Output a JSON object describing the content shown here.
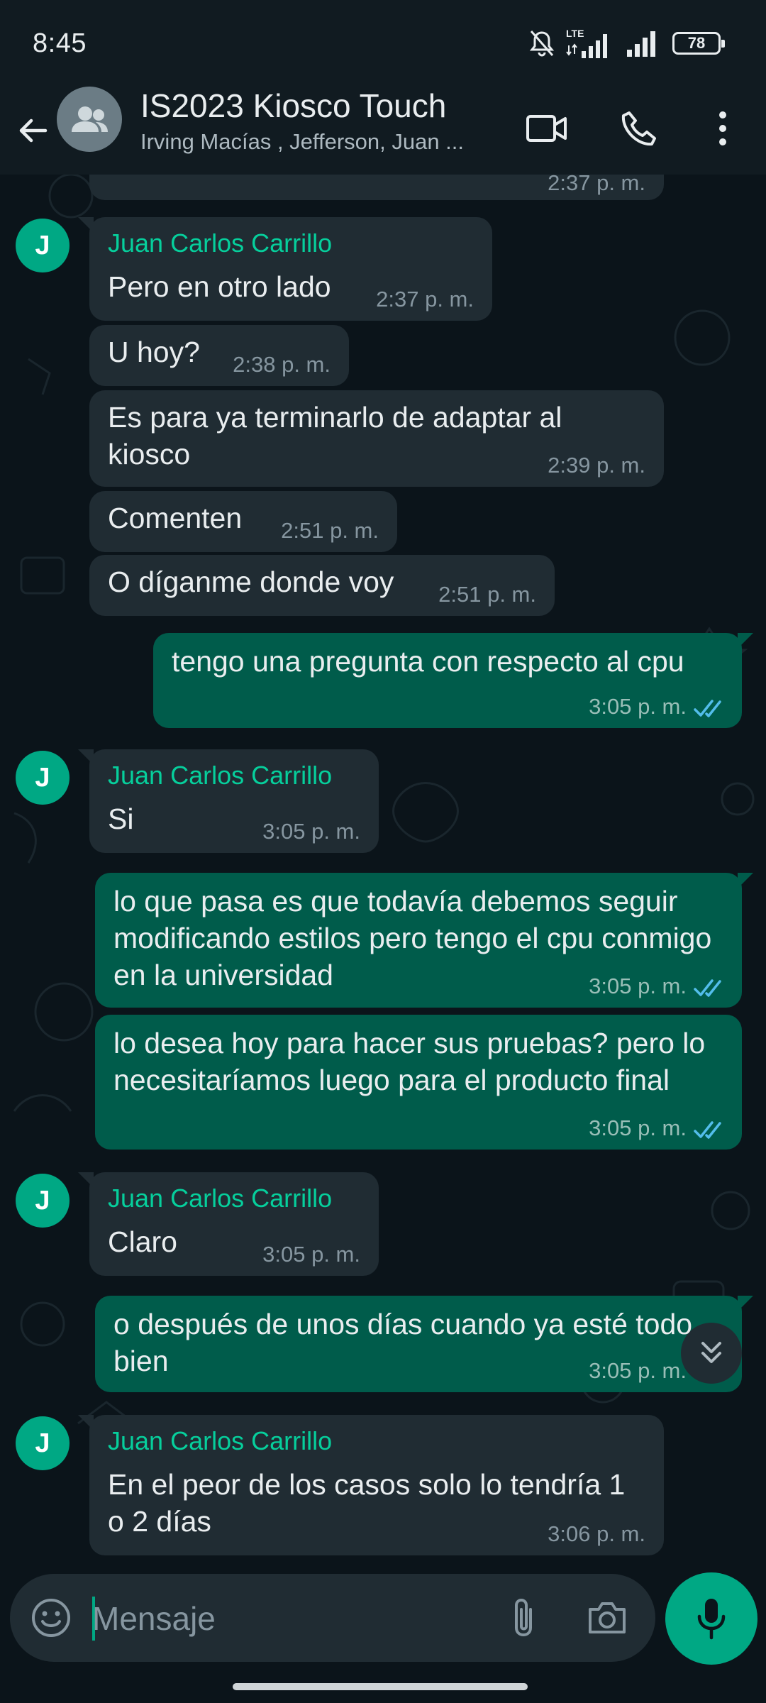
{
  "status_bar": {
    "time": "8:45",
    "network": "LTE",
    "battery": "78"
  },
  "header": {
    "title": "IS2023 Kiosco Touch",
    "subtitle": "Irving Macías , Jefferson, Juan ...",
    "icons": [
      "back-arrow-icon",
      "group-avatar-icon",
      "video-call-icon",
      "phone-icon",
      "more-vertical-icon"
    ]
  },
  "messages": [
    {
      "type": "in",
      "time": "2:37 p. m."
    },
    {
      "type": "in",
      "avatar": "J",
      "sender": "Juan Carlos Carrillo",
      "text": "Pero en otro lado",
      "time": "2:37 p. m."
    },
    {
      "type": "in",
      "text": "U hoy?",
      "time": "2:38 p. m."
    },
    {
      "type": "in",
      "text": "Es para ya terminarlo de adaptar al kiosco",
      "time": "2:39 p. m."
    },
    {
      "type": "in",
      "text": "Comenten",
      "time": "2:51 p. m."
    },
    {
      "type": "in",
      "text": "O díganme donde voy",
      "time": "2:51 p. m."
    },
    {
      "type": "out",
      "text": "tengo una pregunta con respecto al cpu",
      "time": "3:05 p. m.",
      "status": "read"
    },
    {
      "type": "in",
      "avatar": "J",
      "sender": "Juan Carlos Carrillo",
      "text": "Si",
      "time": "3:05 p. m."
    },
    {
      "type": "out",
      "text": "lo que pasa es que todavía debemos seguir modificando estilos pero tengo el cpu conmigo en la universidad",
      "time": "3:05 p. m.",
      "status": "read"
    },
    {
      "type": "out",
      "text": "lo desea hoy para hacer sus pruebas? pero lo necesitaríamos luego para el producto final",
      "time": "3:05 p. m.",
      "status": "read"
    },
    {
      "type": "in",
      "avatar": "J",
      "sender": "Juan Carlos Carrillo",
      "text": "Claro",
      "time": "3:05 p. m."
    },
    {
      "type": "out",
      "text": "o después de unos días cuando ya esté todo bien",
      "time": "3:05 p. m.",
      "status": "read"
    },
    {
      "type": "in",
      "avatar": "J",
      "sender": "Juan Carlos Carrillo",
      "text": "En el peor de los casos solo lo tendría 1 o 2 días",
      "time": "3:06 p. m."
    }
  ],
  "input": {
    "placeholder": "Mensaje",
    "icons": [
      "emoji-icon",
      "attach-icon",
      "camera-icon",
      "mic-icon"
    ]
  },
  "colors": {
    "background": "#0b141a",
    "header": "#111b21",
    "incoming_bubble": "#202c33",
    "outgoing_bubble": "#005c4b",
    "accent": "#00a884",
    "sender_name": "#06cf9c",
    "read_ticks": "#53bdeb"
  }
}
